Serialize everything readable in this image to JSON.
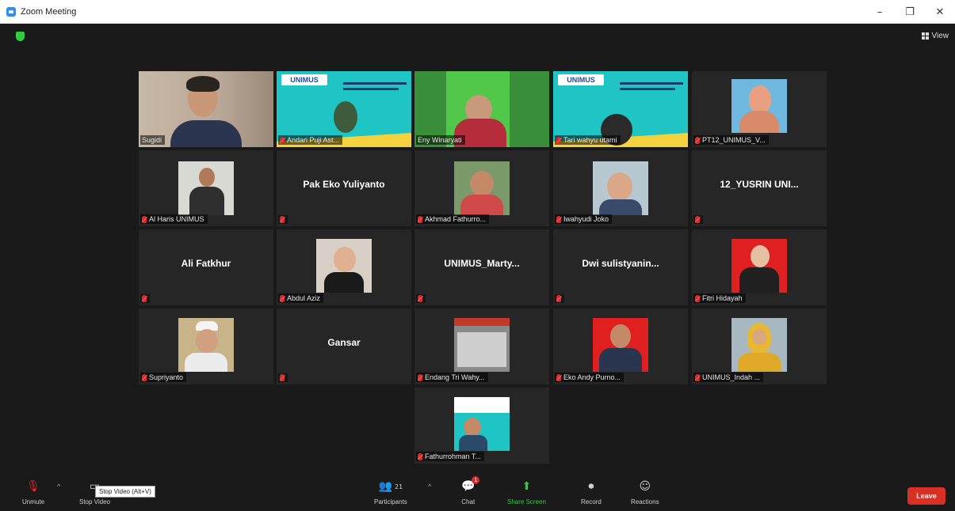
{
  "window": {
    "title": "Zoom Meeting",
    "minimize": "–",
    "restore": "❐",
    "close": "✕"
  },
  "header": {
    "view_label": "View"
  },
  "tiles": [
    {
      "name": "Sugidi",
      "muted": false,
      "type": "video"
    },
    {
      "name": "Andari Puji Ast...",
      "muted": true,
      "type": "slide"
    },
    {
      "name": "Eny Winaryati",
      "muted": false,
      "type": "video",
      "active": true
    },
    {
      "name": "Tari wahyu utami",
      "muted": true,
      "type": "slide"
    },
    {
      "name": "PT12_UNIMUS_V...",
      "muted": true,
      "type": "photo"
    },
    {
      "name": "Al Haris UNIMUS",
      "muted": true,
      "type": "photo"
    },
    {
      "name": "Pak Eko Yuliyanto",
      "muted": true,
      "type": "text"
    },
    {
      "name": "Akhmad Fathurro...",
      "muted": true,
      "type": "photo"
    },
    {
      "name": "Iwahyudi Joko",
      "muted": true,
      "type": "photo"
    },
    {
      "name": "12_YUSRIN UNI...",
      "muted": true,
      "type": "text"
    },
    {
      "name": "Ali Fatkhur",
      "muted": true,
      "type": "text"
    },
    {
      "name": "Abdul Aziz",
      "muted": true,
      "type": "photo"
    },
    {
      "name": "UNIMUS_Marty...",
      "muted": true,
      "type": "text"
    },
    {
      "name": "Dwi sulistyanin...",
      "muted": true,
      "type": "text"
    },
    {
      "name": "Fitri Hidayah",
      "muted": true,
      "type": "photo"
    },
    {
      "name": "Supriyanto",
      "muted": true,
      "type": "photo"
    },
    {
      "name": "Gansar",
      "muted": true,
      "type": "text"
    },
    {
      "name": "Endang Tri Wahy...",
      "muted": true,
      "type": "photo"
    },
    {
      "name": "Eko Andy Purno...",
      "muted": true,
      "type": "photo"
    },
    {
      "name": "UNIMUS_Indah ...",
      "muted": true,
      "type": "photo"
    },
    {
      "name": "Fathurrohman T...",
      "muted": true,
      "type": "slide"
    }
  ],
  "slide": {
    "logo": "UNIMUS"
  },
  "toolbar": {
    "unmute": "Unmute",
    "stop_video": "Stop Video",
    "tooltip": "Stop Video (Alt+V)",
    "participants": "Participants",
    "participants_count": "21",
    "chat": "Chat",
    "chat_badge": "1",
    "share_screen": "Share Screen",
    "record": "Record",
    "reactions": "Reactions",
    "leave": "Leave"
  },
  "colors": {
    "active_speaker": "#e6d23a",
    "leave": "#d93025",
    "share": "#2ecc40",
    "slide_bg": "#1fc4c4"
  }
}
